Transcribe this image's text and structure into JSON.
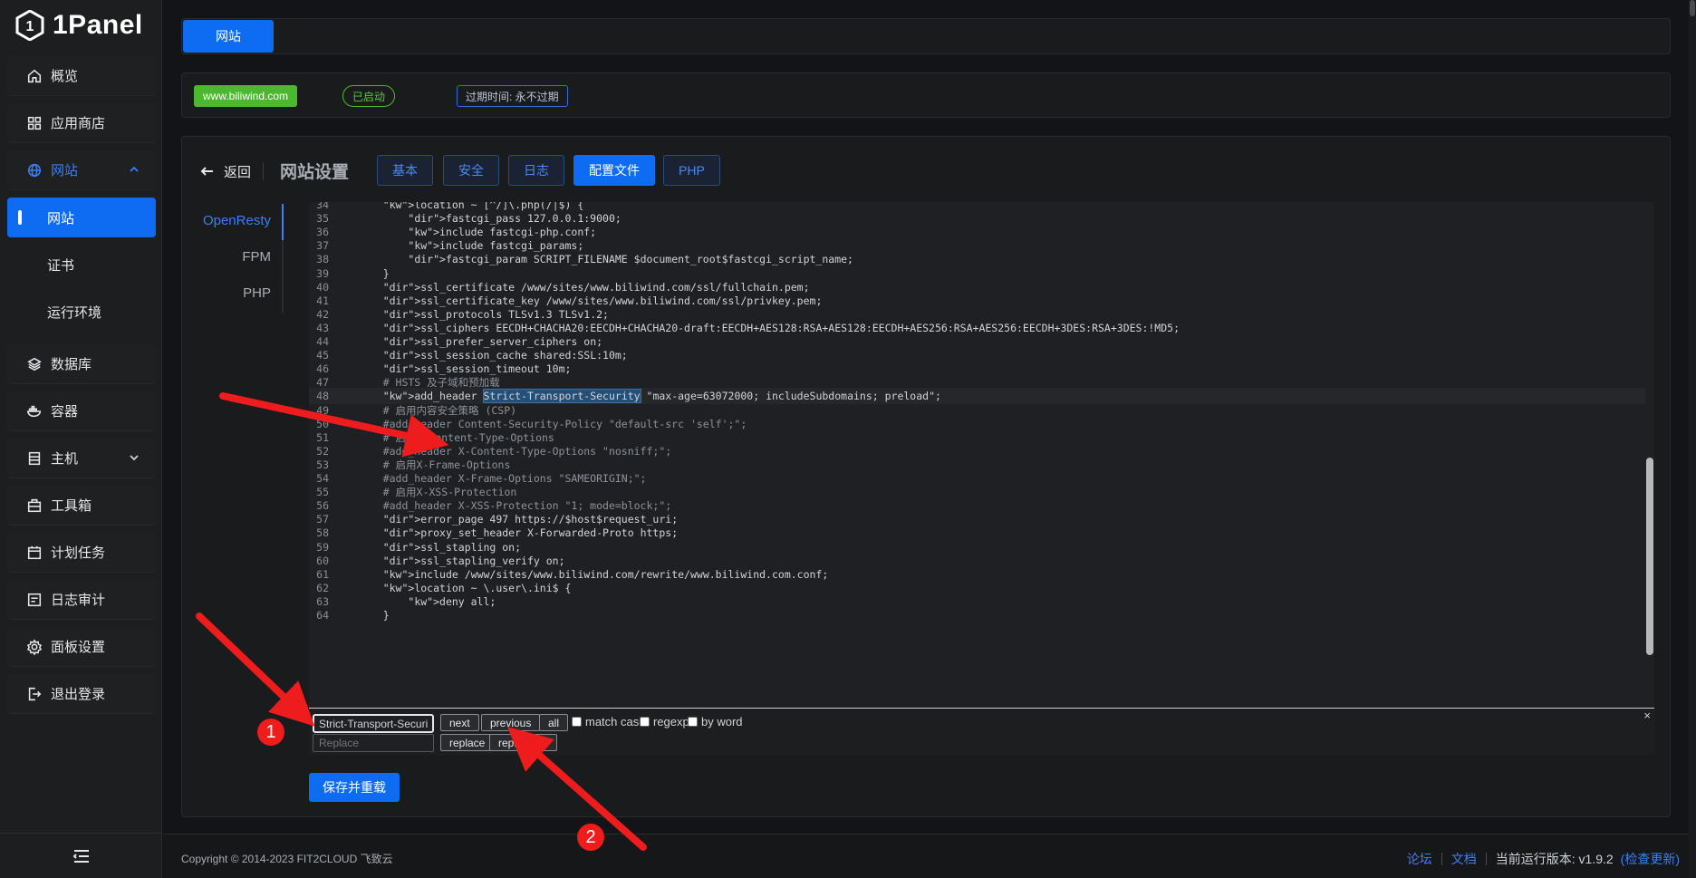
{
  "app": {
    "name": "1Panel"
  },
  "sidebar": {
    "items": [
      {
        "label": "概览",
        "icon": "home-icon"
      },
      {
        "label": "应用商店",
        "icon": "grid-icon"
      },
      {
        "label": "网站",
        "icon": "globe-icon"
      },
      {
        "label": "数据库",
        "icon": "layers-icon"
      },
      {
        "label": "容器",
        "icon": "docker-icon"
      },
      {
        "label": "主机",
        "icon": "server-icon"
      },
      {
        "label": "工具箱",
        "icon": "toolbox-icon"
      },
      {
        "label": "计划任务",
        "icon": "calendar-icon"
      },
      {
        "label": "日志审计",
        "icon": "log-icon"
      },
      {
        "label": "面板设置",
        "icon": "gear-icon"
      },
      {
        "label": "退出登录",
        "icon": "logout-icon"
      }
    ],
    "sub_items": [
      {
        "label": "网站"
      },
      {
        "label": "证书"
      },
      {
        "label": "运行环境"
      }
    ]
  },
  "tabbar": {
    "active_tab": "网站"
  },
  "site_info": {
    "domain": "www.biliwind.com",
    "status": "已启动",
    "expire": "过期时间: 永不过期"
  },
  "panel": {
    "back_label": "返回",
    "title": "网站设置",
    "tabs": [
      "基本",
      "安全",
      "日志",
      "配置文件",
      "PHP"
    ],
    "active_tab": "配置文件",
    "side_tabs": [
      "OpenResty",
      "FPM",
      "PHP"
    ],
    "active_side_tab": "OpenResty"
  },
  "editor": {
    "lines": [
      {
        "n": "34",
        "text": "    location ~ [^/]\\.php(/|$) {"
      },
      {
        "n": "35",
        "text": "        fastcgi_pass 127.0.0.1:9000;"
      },
      {
        "n": "36",
        "text": "        include fastcgi-php.conf;"
      },
      {
        "n": "37",
        "text": "        include fastcgi_params;"
      },
      {
        "n": "38",
        "text": "        fastcgi_param SCRIPT_FILENAME $document_root$fastcgi_script_name;"
      },
      {
        "n": "39",
        "text": "    }"
      },
      {
        "n": "40",
        "text": "    ssl_certificate /www/sites/www.biliwind.com/ssl/fullchain.pem;"
      },
      {
        "n": "41",
        "text": "    ssl_certificate_key /www/sites/www.biliwind.com/ssl/privkey.pem;"
      },
      {
        "n": "42",
        "text": "    ssl_protocols TLSv1.3 TLSv1.2;"
      },
      {
        "n": "43",
        "text": "    ssl_ciphers EECDH+CHACHA20:EECDH+CHACHA20-draft:EECDH+AES128:RSA+AES128:EECDH+AES256:RSA+AES256:EECDH+3DES:RSA+3DES:!MD5;"
      },
      {
        "n": "44",
        "text": "    ssl_prefer_server_ciphers on;"
      },
      {
        "n": "45",
        "text": "    ssl_session_cache shared:SSL:10m;"
      },
      {
        "n": "46",
        "text": "    ssl_session_timeout 10m;"
      },
      {
        "n": "47",
        "text": "    # HSTS 及子域和预加载"
      },
      {
        "n": "48",
        "text": "    add_header Strict-Transport-Security \"max-age=63072000; includeSubdomains; preload\";"
      },
      {
        "n": "49",
        "text": "    # 启用内容安全策略 (CSP)"
      },
      {
        "n": "50",
        "text": "    #add_header Content-Security-Policy \"default-src 'self';\";"
      },
      {
        "n": "51",
        "text": "    # 启用X-Content-Type-Options"
      },
      {
        "n": "52",
        "text": "    #add_header X-Content-Type-Options \"nosniff;\";"
      },
      {
        "n": "53",
        "text": "    # 启用X-Frame-Options"
      },
      {
        "n": "54",
        "text": "    #add_header X-Frame-Options \"SAMEORIGIN;\";"
      },
      {
        "n": "55",
        "text": "    # 启用X-XSS-Protection"
      },
      {
        "n": "56",
        "text": "    #add_header X-XSS-Protection \"1; mode=block;\";"
      },
      {
        "n": "57",
        "text": "    error_page 497 https://$host$request_uri;"
      },
      {
        "n": "58",
        "text": "    proxy_set_header X-Forwarded-Proto https;"
      },
      {
        "n": "59",
        "text": "    ssl_stapling on;"
      },
      {
        "n": "60",
        "text": "    ssl_stapling_verify on;"
      },
      {
        "n": "61",
        "text": "    include /www/sites/www.biliwind.com/rewrite/www.biliwind.com.conf;"
      },
      {
        "n": "62",
        "text": "    location ~ \\.user\\.ini$ {"
      },
      {
        "n": "63",
        "text": "        deny all;"
      },
      {
        "n": "64",
        "text": "    }"
      }
    ]
  },
  "find": {
    "search_value": "Strict-Transport-Security",
    "replace_placeholder": "Replace",
    "next_label": "next",
    "previous_label": "previous",
    "all_label": "all",
    "match_case_label": "match case",
    "regexp_label": "regexp",
    "by_word_label": "by word",
    "replace_label": "replace",
    "replace_all_label": "replace all",
    "close_label": "×"
  },
  "save_label": "保存并重载",
  "footer": {
    "copyright": "Copyright © 2014-2023 FIT2CLOUD 飞致云",
    "forum": "论坛",
    "docs": "文档",
    "version_label": "当前运行版本: v1.9.2",
    "check_update": "(检查更新)"
  },
  "annotations": {
    "marker1": "1",
    "marker2": "2",
    "arrow_color": "#ee1c1c"
  },
  "colors": {
    "accent": "#0d6cf2",
    "success": "#4cb82f",
    "background": "#131417"
  }
}
